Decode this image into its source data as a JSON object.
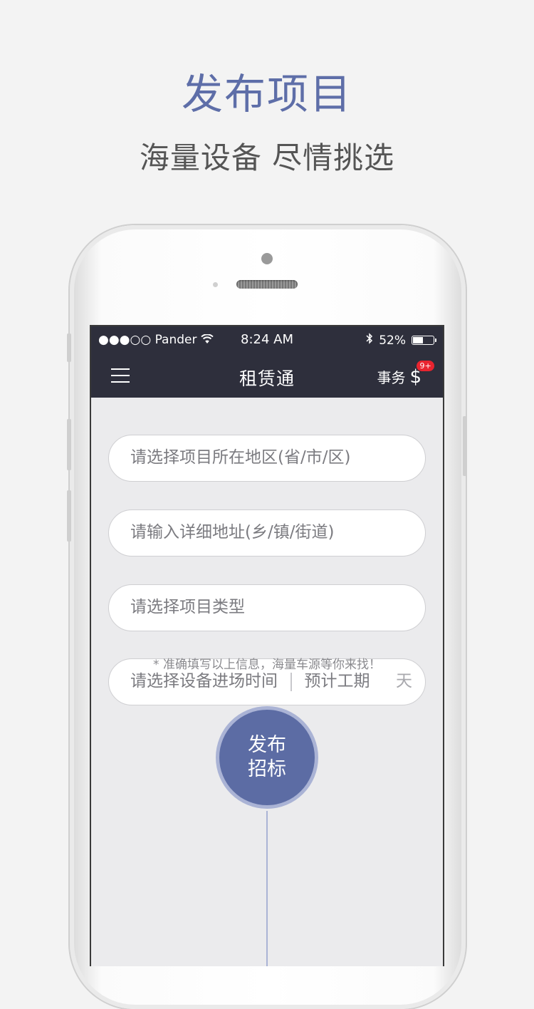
{
  "promo": {
    "headline": "发布项目",
    "subheadline": "海量设备  尽情挑选"
  },
  "status_bar": {
    "carrier": "●●●○○ Pander",
    "wifi_icon": "wifi-icon",
    "time": "8:24 AM",
    "bluetooth_icon": "bluetooth-icon",
    "battery_percent": "52%",
    "battery_level": 0.52
  },
  "navbar": {
    "menu_icon": "hamburger-menu-icon",
    "title": "租赁通",
    "right_label": "事务",
    "dollar_symbol": "$",
    "badge": "9+"
  },
  "form": {
    "region_placeholder": "请选择项目所在地区(省/市/区)",
    "address_placeholder": "请输入详细地址(乡/镇/街道)",
    "type_placeholder": "请选择项目类型",
    "entry_time_placeholder": "请选择设备进场时间",
    "duration_placeholder": "预计工期",
    "duration_unit": "天",
    "note": "* 准确填写以上信息，海量车源等你来找！"
  },
  "publish_button": {
    "line1": "发布",
    "line2": "招标"
  },
  "colors": {
    "accent": "#5c6ca4",
    "navbar": "#2e2f3c",
    "badge": "#e8242f",
    "background": "#ebebed"
  }
}
